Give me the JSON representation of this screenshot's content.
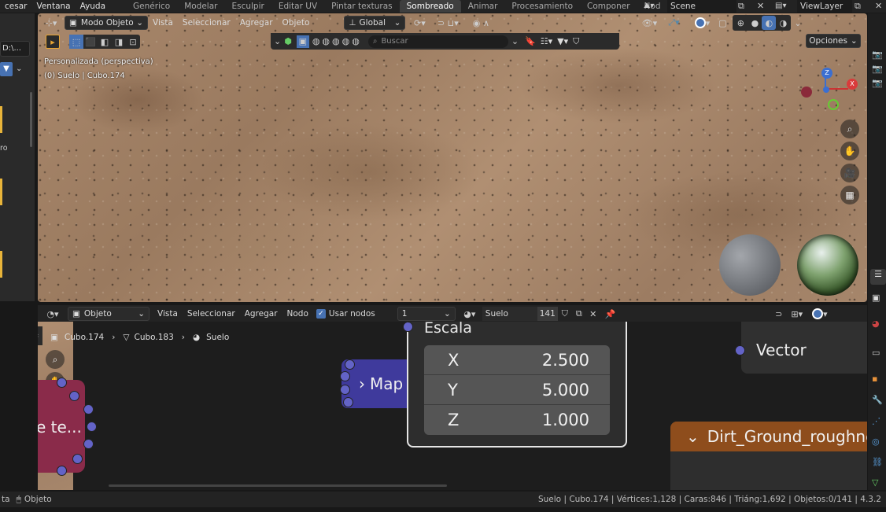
{
  "topbar": {
    "menus": [
      "cesar",
      "Ventana",
      "Ayuda"
    ],
    "workspaces": [
      "Genérico",
      "Modelar",
      "Esculpir",
      "Editar UV",
      "Pintar texturas",
      "Sombreado",
      "Animar",
      "Procesamiento",
      "Componer",
      "Nod"
    ],
    "scene": "Scene",
    "view_layer": "ViewLayer"
  },
  "left": {
    "path": "D:\\...",
    "label": "ro"
  },
  "viewport": {
    "mode": "Modo Objeto",
    "menus": [
      "Vista",
      "Seleccionar",
      "Agregar",
      "Objeto"
    ],
    "transform": "Global",
    "search_placeholder": "Buscar",
    "options": "Opciones",
    "overlay_line1": "Personalizada (perspectiva)",
    "overlay_line2": "(0) Suelo | Cubo.174",
    "gizmo_z": "Z",
    "gizmo_x": "X"
  },
  "node_editor": {
    "type": "Objeto",
    "menus": [
      "Vista",
      "Seleccionar",
      "Agregar",
      "Nodo"
    ],
    "use_nodes": "Usar nodos",
    "slot": "1",
    "material": "Suelo",
    "users": "141",
    "breadcrumb": [
      "Cubo.174",
      "Cubo.183",
      "Suelo"
    ],
    "escala": "Escala",
    "x_label": "X",
    "x_val": "2.500",
    "y_label": "Y",
    "y_val": "5.000",
    "z_label": "Z",
    "z_val": "1.000",
    "mapping": "Map",
    "vector": "Vector",
    "dirt": "Dirt_Ground_roughne",
    "tex_node": "e te..."
  },
  "status": {
    "left_a": "ta",
    "left_b": "Objeto",
    "info": "Suelo | Cubo.174 | Vértices:1,128 | Caras:846 | Triáng:1,692 | Objetos:0/141 | 4.3.2"
  },
  "colors": {
    "socket": "#6363c7",
    "mapping_node": "#3f3a9c",
    "tex_node": "#8a2b4a",
    "dirt_header": "#8e4d1c",
    "accent": "#4772b3"
  }
}
